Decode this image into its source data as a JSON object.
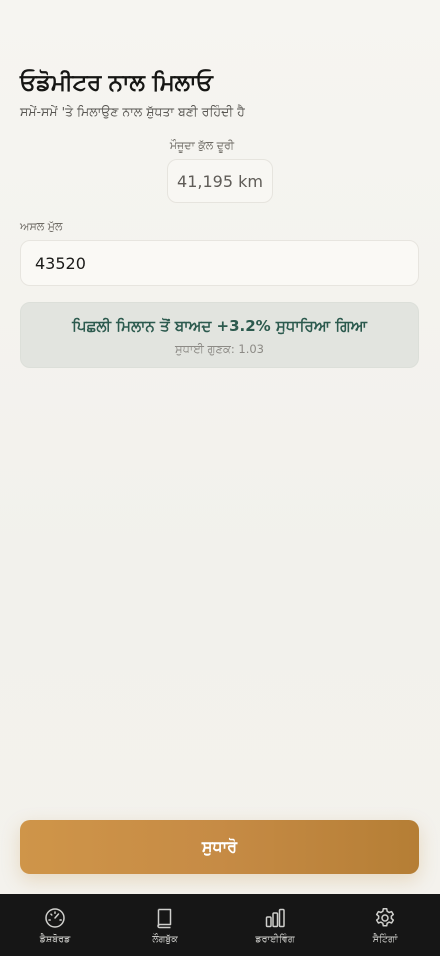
{
  "header": {
    "title": "ਓਡੋਮੀਟਰ ਨਾਲ ਮਿਲਾਓ",
    "subtitle": "ਸਮੇਂ-ਸਮੇਂ 'ਤੇ ਮਿਲਾਉਣ ਨਾਲ ਸ਼ੁੱਧਤਾ ਬਣੀ ਰਹਿੰਦੀ ਹੈ"
  },
  "current": {
    "label": "ਮੌਜੂਦਾ ਕੁੱਲ ਦੂਰੀ",
    "value": "41,195 km"
  },
  "actual": {
    "label": "ਅਸਲ ਮੁੱਲ",
    "value": "43520"
  },
  "info": {
    "main": "ਪਿਛਲੀ ਮਿਲਾਨ ਤੋਂ ਬਾਅਦ +3.2% ਸੁਧਾਰਿਆ ਗਿਆ",
    "sub": "ਸੁਧਾਈ ਗੁਣਕ: 1.03"
  },
  "button": {
    "label": "ਸੁਧਾਰੋ"
  },
  "colors": {
    "accent": "#c68b45",
    "info_text": "#2c5a4e",
    "tabbar": "#161616"
  },
  "tabs": [
    {
      "label": "ਡੈਸ਼ਬੋਰਡ",
      "icon": "speedometer-icon"
    },
    {
      "label": "ਲੌਗਬੁੱਕ",
      "icon": "book-icon"
    },
    {
      "label": "ਡਰਾਈਵਿੰਗ",
      "icon": "bar-chart-icon"
    },
    {
      "label": "ਸੈਟਿੰਗਾਂ",
      "icon": "gear-icon"
    }
  ]
}
